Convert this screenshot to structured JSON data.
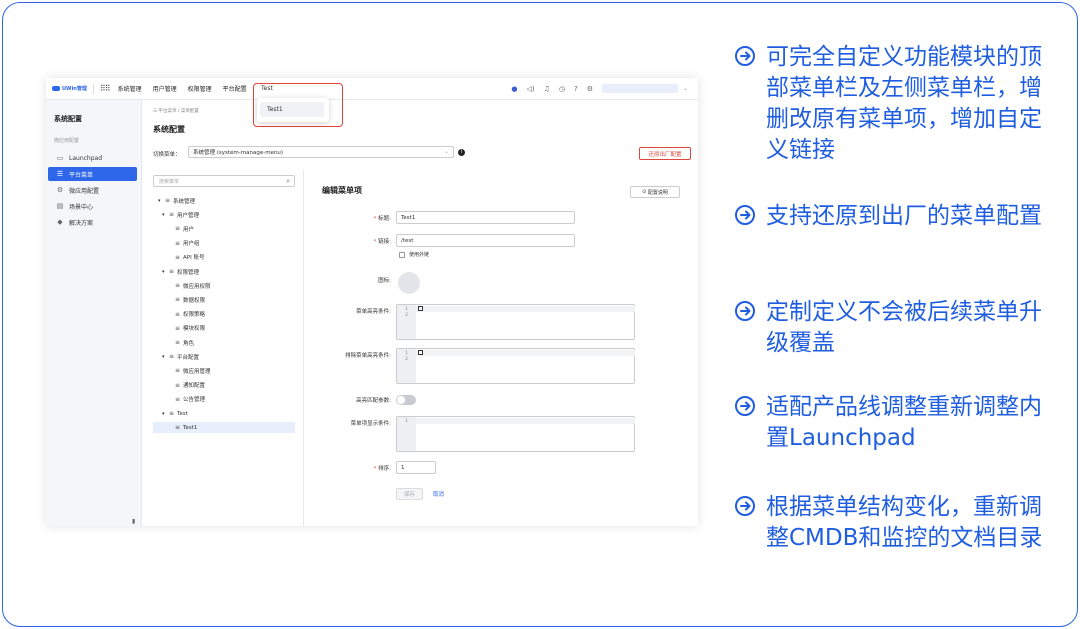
{
  "topbar": {
    "logo_text": "UWin管理",
    "nav": [
      "系统管理",
      "用户管理",
      "权限管理",
      "平台配置",
      "Test"
    ]
  },
  "sidebar": {
    "title": "系统配置",
    "group_label": "微应用配置",
    "items": [
      {
        "label": "Launchpad",
        "icon": "monitor-icon",
        "active": false
      },
      {
        "label": "平台菜单",
        "icon": "menu-icon",
        "active": true
      },
      {
        "label": "微应用配置",
        "icon": "gear-icon",
        "active": false
      },
      {
        "label": "场景中心",
        "icon": "scene-icon",
        "active": false
      },
      {
        "label": "解决方案",
        "icon": "solution-icon",
        "active": false
      }
    ]
  },
  "main": {
    "breadcrumb": "☰ 平台菜单 / 菜单配置",
    "title": "系统配置",
    "switch_label": "切换菜单：",
    "switch_value": "系统管理 (system-manage-menu)",
    "restore_button": "还原出厂配置",
    "search_placeholder": "搜索菜单",
    "tree": [
      {
        "label": "系统管理",
        "level": 0,
        "caret": "▾"
      },
      {
        "label": "用户管理",
        "level": 1,
        "caret": "▾"
      },
      {
        "label": "用户",
        "level": 2,
        "caret": ""
      },
      {
        "label": "用户组",
        "level": 2,
        "caret": ""
      },
      {
        "label": "API 账号",
        "level": 2,
        "caret": ""
      },
      {
        "label": "权限管理",
        "level": 1,
        "caret": "▾"
      },
      {
        "label": "微应用权限",
        "level": 2,
        "caret": ""
      },
      {
        "label": "数据权限",
        "level": 2,
        "caret": ""
      },
      {
        "label": "权限策略",
        "level": 2,
        "caret": ""
      },
      {
        "label": "模块权限",
        "level": 2,
        "caret": ""
      },
      {
        "label": "角色",
        "level": 2,
        "caret": ""
      },
      {
        "label": "平台配置",
        "level": 1,
        "caret": "▾"
      },
      {
        "label": "微应用管理",
        "level": 2,
        "caret": ""
      },
      {
        "label": "通知配置",
        "level": 2,
        "caret": ""
      },
      {
        "label": "公告管理",
        "level": 2,
        "caret": ""
      },
      {
        "label": "Test",
        "level": 1,
        "caret": "▾"
      },
      {
        "label": "Test1",
        "level": 2,
        "caret": "",
        "selected": true
      }
    ],
    "edit": {
      "title": "编辑菜单项",
      "help_button": "配置说明",
      "title_label": "标题:",
      "title_value": "Test1",
      "link_label": "链接:",
      "link_value": "/test",
      "external_label": "使用外链",
      "icon_label": "图标:",
      "highlight_label": "菜单高亮条件:",
      "exclude_label": "排除菜单高亮条件:",
      "param_label": "高亮匹配参数:",
      "display_label": "菜单项显示条件:",
      "sort_label": "排序:",
      "sort_value": "1",
      "save_button": "保存",
      "cancel_button": "取消"
    }
  },
  "dropdown": {
    "item": "Test1"
  },
  "features": [
    "可完全自定义功能模块的顶部菜单栏及左侧菜单栏，增删改原有菜单项，增加自定义链接",
    "支持还原到出厂的菜单配置",
    "定制定义不会被后续菜单升级覆盖",
    "适配产品线调整重新调整内置Launchpad",
    "根据菜单结构变化，重新调整CMDB和监控的文档目录"
  ],
  "colors": {
    "accent": "#2d66e8",
    "danger": "#e0463a"
  }
}
